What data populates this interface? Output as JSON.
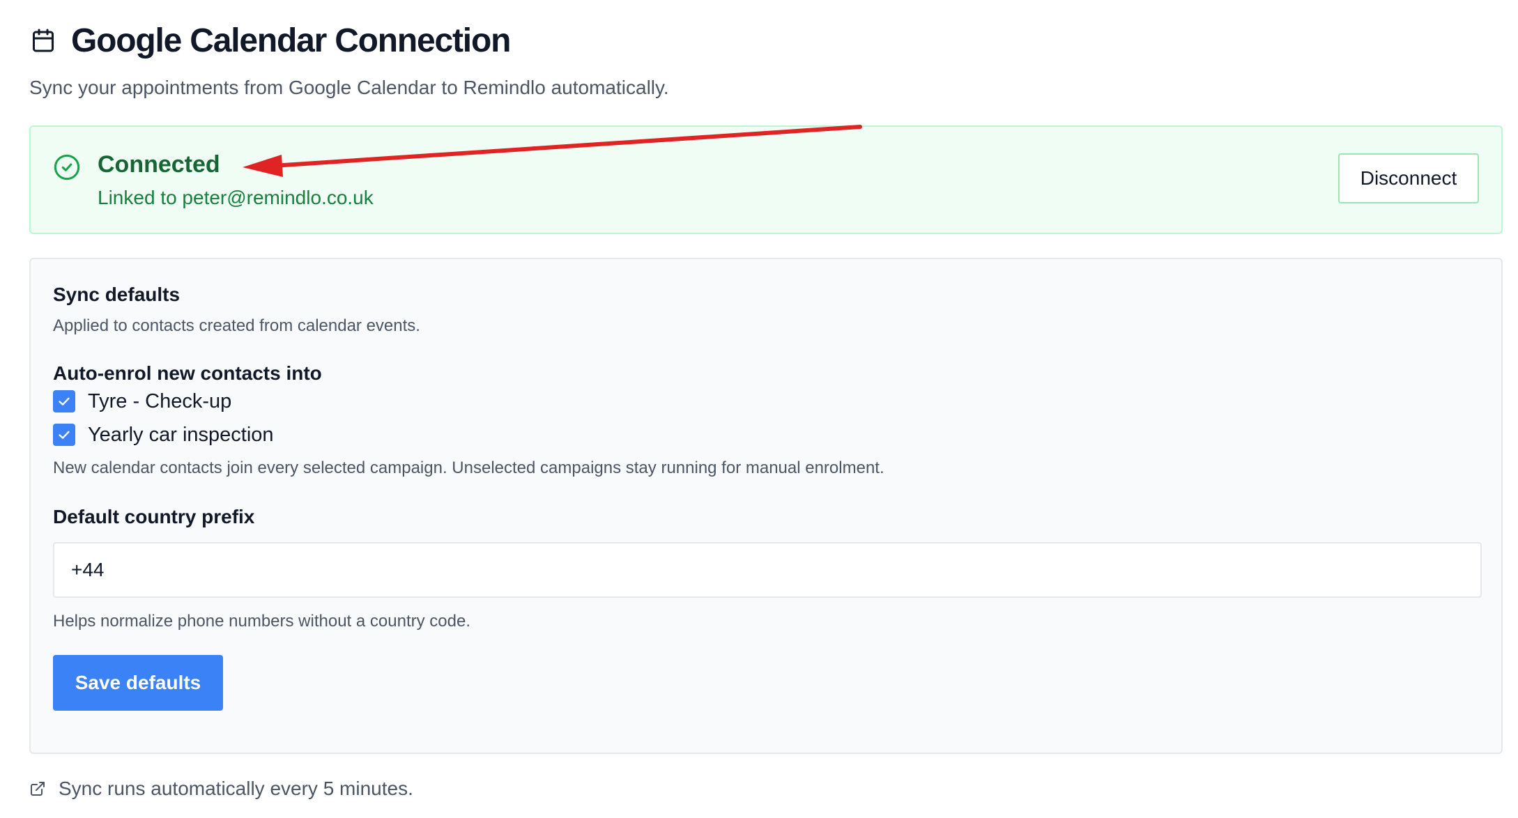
{
  "header": {
    "title": "Google Calendar Connection",
    "subtitle": "Sync your appointments from Google Calendar to Remindlo automatically.",
    "icon": "calendar-icon"
  },
  "status": {
    "title": "Connected",
    "linked_text": "Linked to peter@remindlo.co.uk",
    "icon": "check-circle-icon",
    "disconnect_label": "Disconnect",
    "accent_color": "#166534",
    "background_color": "#f0fdf4"
  },
  "annotation": {
    "arrow_color": "#e02424"
  },
  "defaults": {
    "title": "Sync defaults",
    "description": "Applied to contacts created from calendar events.",
    "enrol_title": "Auto-enrol new contacts into",
    "campaigns": [
      {
        "label": "Tyre - Check-up",
        "checked": true
      },
      {
        "label": "Yearly car inspection",
        "checked": true
      }
    ],
    "enrol_note": "New calendar contacts join every selected campaign. Unselected campaigns stay running for manual enrolment.",
    "prefix_title": "Default country prefix",
    "prefix_value": "+44",
    "prefix_help": "Helps normalize phone numbers without a country code.",
    "save_label": "Save defaults",
    "primary_color": "#3b82f6"
  },
  "footer": {
    "note": "Sync runs automatically every 5 minutes.",
    "icon": "external-link-icon"
  }
}
